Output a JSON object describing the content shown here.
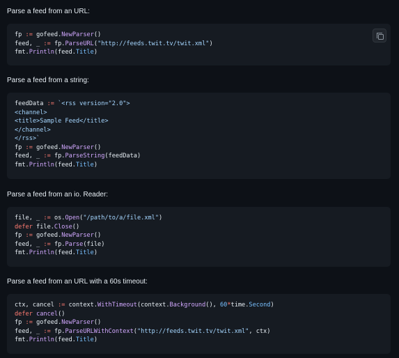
{
  "sections": [
    {
      "title": "Parse a feed from an URL:",
      "copy_icon": "copy-icon",
      "lines": [
        [
          [
            "fp ",
            ""
          ],
          [
            ":=",
            "k"
          ],
          [
            " gofeed.",
            ""
          ],
          [
            "NewParser",
            "f"
          ],
          [
            "()",
            ""
          ]
        ],
        [
          [
            "feed, _ ",
            ""
          ],
          [
            ":=",
            "k"
          ],
          [
            " fp.",
            ""
          ],
          [
            "ParseURL",
            "f"
          ],
          [
            "(",
            ""
          ],
          [
            "\"http://feeds.twit.tv/twit.xml\"",
            "s"
          ],
          [
            ")",
            ""
          ]
        ],
        [
          [
            "fmt.",
            ""
          ],
          [
            "Println",
            "f"
          ],
          [
            "(feed.",
            ""
          ],
          [
            "Title",
            "n"
          ],
          [
            ")",
            ""
          ]
        ]
      ]
    },
    {
      "title": "Parse a feed from a string:",
      "lines": [
        [
          [
            "feedData ",
            ""
          ],
          [
            ":=",
            "k"
          ],
          [
            " ",
            ""
          ],
          [
            "`<rss version=\"2.0\">",
            "s"
          ]
        ],
        [
          [
            "<channel>",
            "s"
          ]
        ],
        [
          [
            "<title>Sample Feed</title>",
            "s"
          ]
        ],
        [
          [
            "</channel>",
            "s"
          ]
        ],
        [
          [
            "</rss>`",
            "s"
          ]
        ],
        [
          [
            "fp ",
            ""
          ],
          [
            ":=",
            "k"
          ],
          [
            " gofeed.",
            ""
          ],
          [
            "NewParser",
            "f"
          ],
          [
            "()",
            ""
          ]
        ],
        [
          [
            "feed, _ ",
            ""
          ],
          [
            ":=",
            "k"
          ],
          [
            " fp.",
            ""
          ],
          [
            "ParseString",
            "f"
          ],
          [
            "(feedData)",
            ""
          ]
        ],
        [
          [
            "fmt.",
            ""
          ],
          [
            "Println",
            "f"
          ],
          [
            "(feed.",
            ""
          ],
          [
            "Title",
            "n"
          ],
          [
            ")",
            ""
          ]
        ]
      ]
    },
    {
      "title": "Parse a feed from an io. Reader:",
      "lines": [
        [
          [
            "file, _ ",
            ""
          ],
          [
            ":=",
            "k"
          ],
          [
            " os.",
            ""
          ],
          [
            "Open",
            "f"
          ],
          [
            "(",
            ""
          ],
          [
            "\"/path/to/a/file.xml\"",
            "s"
          ],
          [
            ")",
            ""
          ]
        ],
        [
          [
            "defer",
            "k"
          ],
          [
            " file.",
            ""
          ],
          [
            "Close",
            "f"
          ],
          [
            "()",
            ""
          ]
        ],
        [
          [
            "fp ",
            ""
          ],
          [
            ":=",
            "k"
          ],
          [
            " gofeed.",
            ""
          ],
          [
            "NewParser",
            "f"
          ],
          [
            "()",
            ""
          ]
        ],
        [
          [
            "feed, _ ",
            ""
          ],
          [
            ":=",
            "k"
          ],
          [
            " fp.",
            ""
          ],
          [
            "Parse",
            "f"
          ],
          [
            "(file)",
            ""
          ]
        ],
        [
          [
            "fmt.",
            ""
          ],
          [
            "Println",
            "f"
          ],
          [
            "(feed.",
            ""
          ],
          [
            "Title",
            "n"
          ],
          [
            ")",
            ""
          ]
        ]
      ]
    },
    {
      "title": "Parse a feed from an URL with a 60s timeout:",
      "lines": [
        [
          [
            "ctx, cancel ",
            ""
          ],
          [
            ":=",
            "k"
          ],
          [
            " context.",
            ""
          ],
          [
            "WithTimeout",
            "f"
          ],
          [
            "(context.",
            ""
          ],
          [
            "Background",
            "f"
          ],
          [
            "(), ",
            ""
          ],
          [
            "60",
            "n"
          ],
          [
            "*",
            "k"
          ],
          [
            "time.",
            ""
          ],
          [
            "Second",
            "n"
          ],
          [
            ")",
            ""
          ]
        ],
        [
          [
            "defer",
            "k"
          ],
          [
            " ",
            ""
          ],
          [
            "cancel",
            "f"
          ],
          [
            "()",
            ""
          ]
        ],
        [
          [
            "fp ",
            ""
          ],
          [
            ":=",
            "k"
          ],
          [
            " gofeed.",
            ""
          ],
          [
            "NewParser",
            "f"
          ],
          [
            "()",
            ""
          ]
        ],
        [
          [
            "feed, _ ",
            ""
          ],
          [
            ":=",
            "k"
          ],
          [
            " fp.",
            ""
          ],
          [
            "ParseURLWithContext",
            "f"
          ],
          [
            "(",
            ""
          ],
          [
            "\"http://feeds.twit.tv/twit.xml\"",
            "s"
          ],
          [
            ", ctx)",
            ""
          ]
        ],
        [
          [
            "fmt.",
            ""
          ],
          [
            "Println",
            "f"
          ],
          [
            "(feed.",
            ""
          ],
          [
            "Title",
            "n"
          ],
          [
            ")",
            ""
          ]
        ]
      ]
    }
  ]
}
